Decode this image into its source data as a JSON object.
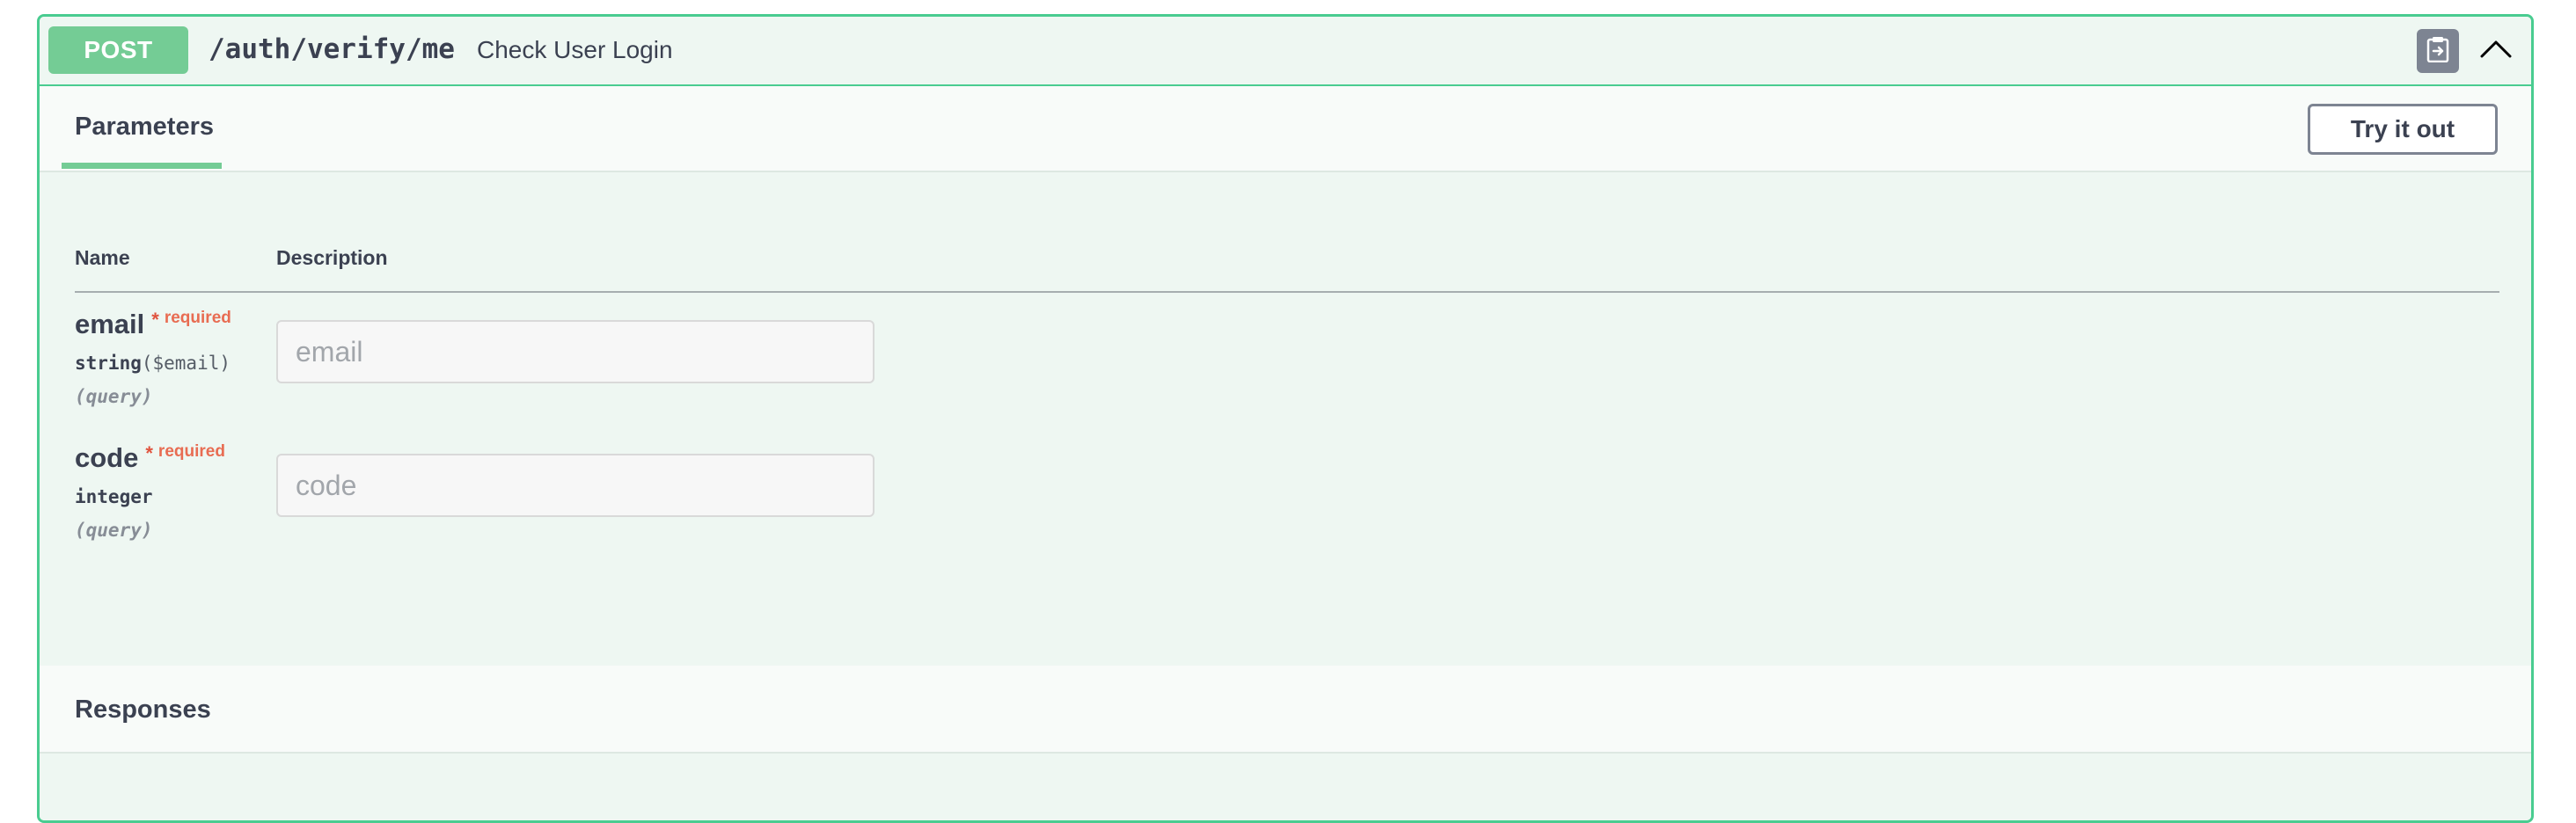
{
  "operation": {
    "method": "POST",
    "path": "/auth/verify/me",
    "summary": "Check User Login"
  },
  "icons": {
    "copy": "clipboard-copy-icon",
    "collapse": "chevron-up-icon"
  },
  "tabs": {
    "parameters_label": "Parameters",
    "try_button_label": "Try it out"
  },
  "table": {
    "col_name": "Name",
    "col_description": "Description"
  },
  "parameters": [
    {
      "name": "email",
      "star": "*",
      "required_label": "required",
      "type": "string",
      "format": "($email)",
      "in": "(query)",
      "placeholder": "email",
      "value": ""
    },
    {
      "name": "code",
      "star": "*",
      "required_label": "required",
      "type": "integer",
      "format": "",
      "in": "(query)",
      "placeholder": "code",
      "value": ""
    }
  ],
  "responses": {
    "label": "Responses"
  },
  "colors": {
    "method_bg": "#74cc95",
    "border": "#49cc90",
    "block_bg": "#eef7f2",
    "required": "#e86c52"
  }
}
